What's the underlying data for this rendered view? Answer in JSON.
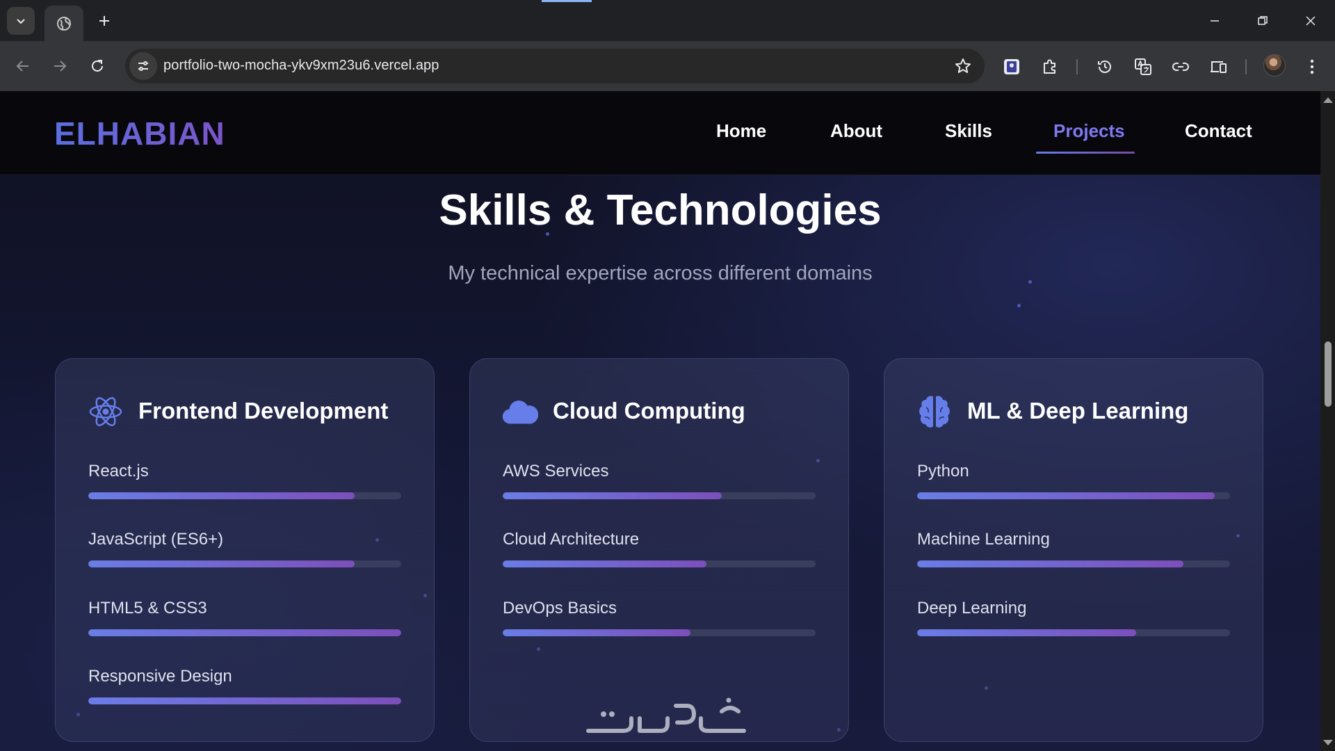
{
  "browser": {
    "url": "portfolio-two-mocha-ykv9xm23u6.vercel.app"
  },
  "site": {
    "logo": "ELHABIAN",
    "nav": [
      "Home",
      "About",
      "Skills",
      "Projects",
      "Contact"
    ],
    "active_nav": "Projects"
  },
  "section": {
    "title": "Skills & Technologies",
    "subtitle": "My technical expertise across different domains"
  },
  "cards": [
    {
      "title": "Frontend Development",
      "icon": "react-atom-icon",
      "skills": [
        {
          "name": "React.js",
          "level": 0.85
        },
        {
          "name": "JavaScript (ES6+)",
          "level": 0.85
        },
        {
          "name": "HTML5 & CSS3",
          "level": 1.0
        },
        {
          "name": "Responsive Design",
          "level": 1.0
        }
      ]
    },
    {
      "title": "Cloud Computing",
      "icon": "cloud-icon",
      "skills": [
        {
          "name": "AWS Services",
          "level": 0.7
        },
        {
          "name": "Cloud Architecture",
          "level": 0.65
        },
        {
          "name": "DevOps Basics",
          "level": 0.6
        }
      ]
    },
    {
      "title": "ML & Deep Learning",
      "icon": "brain-icon",
      "skills": [
        {
          "name": "Python",
          "level": 0.95
        },
        {
          "name": "Machine Learning",
          "level": 0.85
        },
        {
          "name": "Deep Learning",
          "level": 0.7
        }
      ]
    }
  ],
  "colors": {
    "accent": "#667eea",
    "accent2": "#764ba2",
    "active_nav": "#7f79f0"
  }
}
